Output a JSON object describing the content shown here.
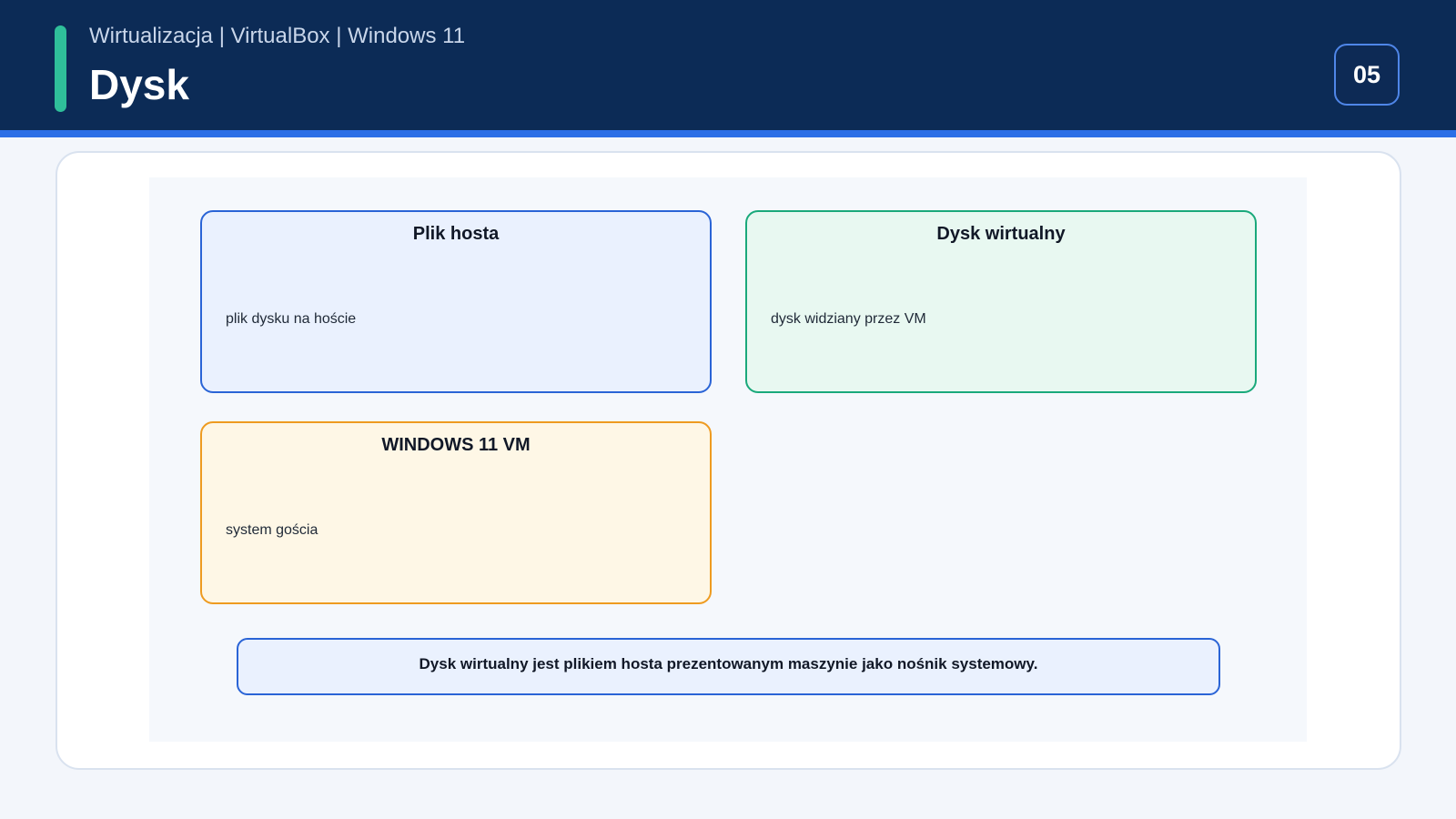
{
  "header": {
    "subtitle": "Wirtualizacja | VirtualBox | Windows 11",
    "title": "Dysk",
    "slide_number": "05"
  },
  "diagram": {
    "cards": [
      {
        "title": "Plik hosta",
        "text": "plik dysku na hoście",
        "color": "#2a64d6"
      },
      {
        "title": "Dysk wirtualny",
        "text": "dysk widziany przez VM",
        "color": "#1aa97b"
      },
      {
        "title": "WINDOWS 11 VM",
        "text": "system gościa",
        "color": "#ee9b20"
      }
    ],
    "summary": "Dysk wirtualny jest plikiem hosta prezentowanym maszynie jako nośnik systemowy."
  },
  "colors": {
    "header_bg": "#0c2b56",
    "accent": "#2fbf9a",
    "underline": "#2c6fe6"
  }
}
